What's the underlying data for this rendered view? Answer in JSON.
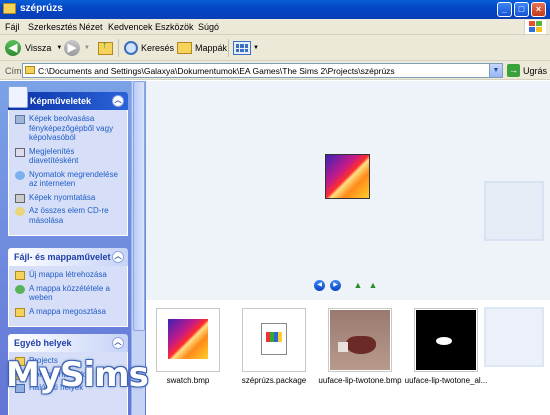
{
  "window": {
    "title": "széprúzs"
  },
  "menu": [
    "Fájl",
    "Szerkesztés",
    "Nézet",
    "Kedvencek",
    "Eszközök",
    "Súgó"
  ],
  "toolbar": {
    "back_label": "Vissza",
    "search_label": "Keresés",
    "folders_label": "Mappák"
  },
  "address": {
    "label": "Cím",
    "path": "C:\\Documents and Settings\\Galaxya\\Dokumentumok\\EA Games\\The Sims 2\\Projects\\széprúzs",
    "go_label": "Ugrás"
  },
  "panels": {
    "images": {
      "title": "Képműveletek",
      "tasks": [
        "Képek beolvasása fényképezőgépből vagy képolvasóból",
        "Megjelenítés diavetítésként",
        "Nyomatok megrendelése az interneten",
        "Képek nyomtatása",
        "Az összes elem CD-re másolása"
      ]
    },
    "file": {
      "title": "Fájl- és mappaművelet",
      "tasks": [
        "Új mappa létrehozása",
        "A mappa közzététele a weben",
        "A mappa megosztása"
      ]
    },
    "other": {
      "title": "Egyéb helyek",
      "tasks": [
        "Projects",
        "Dokumentumok",
        "Hálózati helyek"
      ]
    }
  },
  "files": [
    {
      "name": "swatch.bmp"
    },
    {
      "name": "széprúzs.package"
    },
    {
      "name": "uuface-lip-twotone.bmp"
    },
    {
      "name": "uuface-lip-twotone_al..."
    }
  ],
  "watermark": {
    "text": "MySims"
  },
  "colors": {
    "titlebar": "#0a5fd6",
    "taskpane": "#7ba2e7",
    "link": "#215dc6"
  }
}
